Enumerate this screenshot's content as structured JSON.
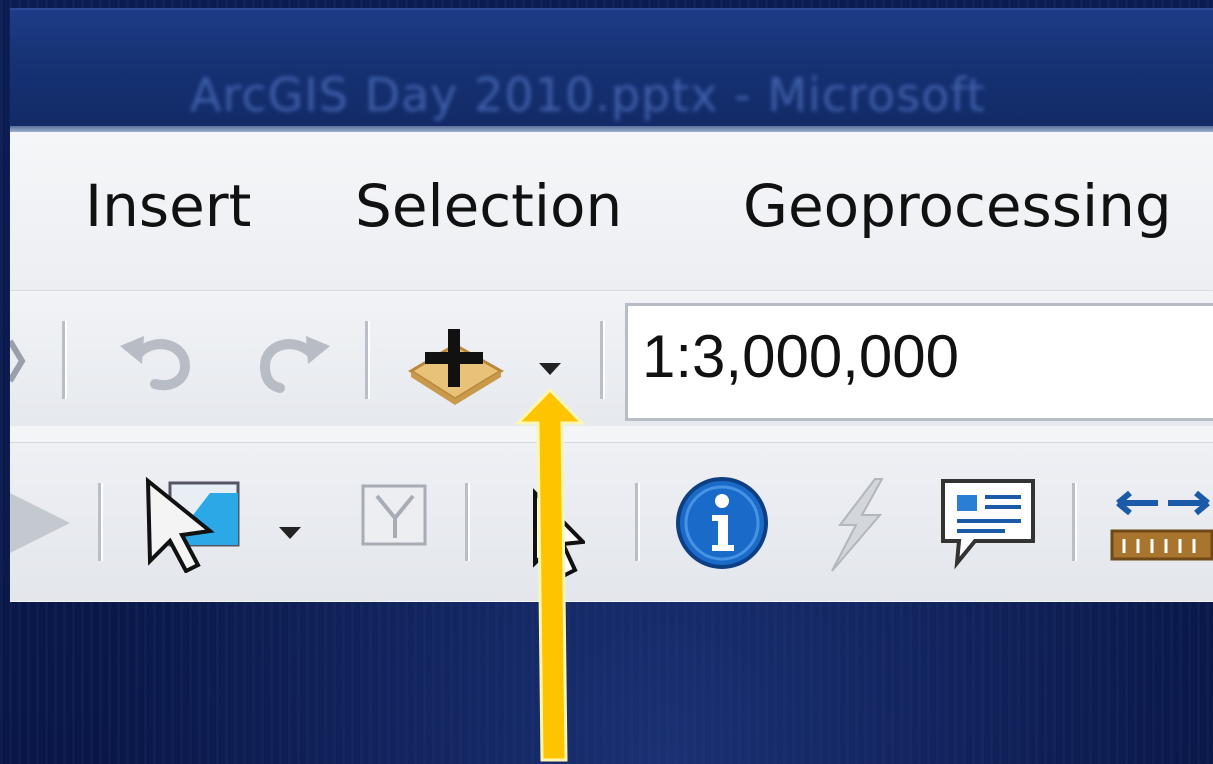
{
  "window": {
    "title": "ArcGIS Day 2010.pptx - Microsoft"
  },
  "menubar": {
    "items": [
      {
        "label": "Insert"
      },
      {
        "label": "Selection"
      },
      {
        "label": "Geoprocessing"
      }
    ]
  },
  "standard_toolbar": {
    "undo_icon": "undo-icon",
    "redo_icon": "redo-icon",
    "add_data_icon": "add-data-icon",
    "map_scale": {
      "value": "1:3,000,000"
    }
  },
  "tools_toolbar": {
    "icons": [
      "forward-extent-icon",
      "select-features-icon",
      "clear-selection-icon",
      "select-elements-icon",
      "identify-icon",
      "hyperlink-icon",
      "html-popup-icon",
      "measure-icon"
    ]
  },
  "colors": {
    "background": "#0a1a4a",
    "titlebar": "#163274",
    "panel": "#f4f5f7",
    "annotation_arrow": "#ffc400",
    "identify_blue": "#1a6bc9"
  }
}
